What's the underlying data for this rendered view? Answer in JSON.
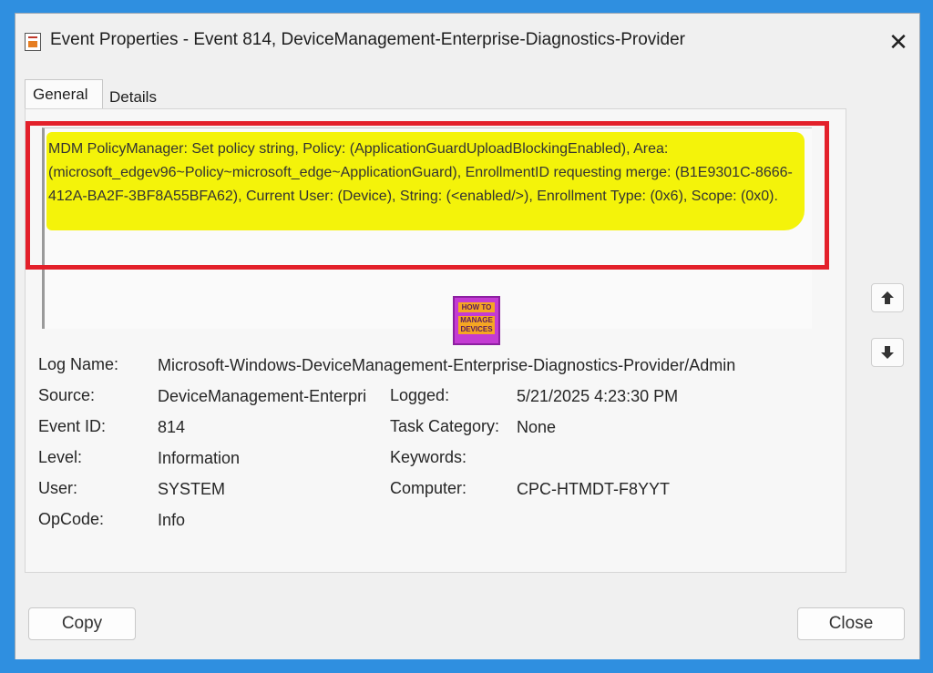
{
  "window": {
    "title": "Event Properties - Event 814, DeviceManagement-Enterprise-Diagnostics-Provider"
  },
  "tabs": [
    "General",
    "Details"
  ],
  "description": "MDM PolicyManager: Set policy string, Policy: (ApplicationGuardUploadBlockingEnabled), Area: (microsoft_edgev96~Policy~microsoft_edge~ApplicationGuard), EnrollmentID requesting merge: (B1E9301C-8666-412A-BA2F-3BF8A55BFA62), Current User: (Device), String: (<enabled/>), Enrollment Type: (0x6), Scope: (0x0).",
  "logo": {
    "line1": "HOW TO",
    "line2": "MANAGE",
    "line3": "DEVICES"
  },
  "fields": {
    "log_name": {
      "label": "Log Name:",
      "value": "Microsoft-Windows-DeviceManagement-Enterprise-Diagnostics-Provider/Admin"
    },
    "source": {
      "label": "Source:",
      "value": "DeviceManagement-Enterpri"
    },
    "logged": {
      "label": "Logged:",
      "value": "5/21/2025 4:23:30 PM"
    },
    "event_id": {
      "label": "Event ID:",
      "value": "814"
    },
    "task_category": {
      "label": "Task Category:",
      "value": "None"
    },
    "level": {
      "label": "Level:",
      "value": "Information"
    },
    "keywords": {
      "label": "Keywords:",
      "value": ""
    },
    "user": {
      "label": "User:",
      "value": "SYSTEM"
    },
    "computer": {
      "label": "Computer:",
      "value": "CPC-HTMDT-F8YYT"
    },
    "opcode": {
      "label": "OpCode:",
      "value": "Info"
    }
  },
  "buttons": {
    "copy": "Copy",
    "close": "Close"
  },
  "colors": {
    "highlight": "#f4f30a",
    "annotation_border": "#e3202a",
    "background": "#2f8fe0"
  }
}
